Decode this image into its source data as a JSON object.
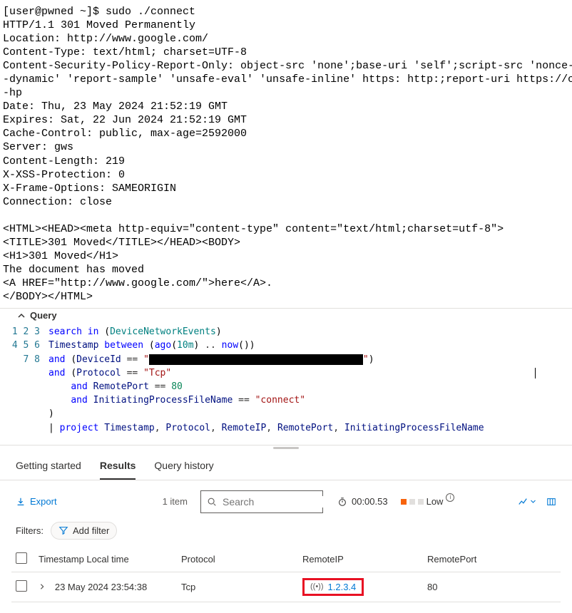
{
  "terminal": {
    "text": "[user@pwned ~]$ sudo ./connect\nHTTP/1.1 301 Moved Permanently\nLocation: http://www.google.com/\nContent-Type: text/html; charset=UTF-8\nContent-Security-Policy-Report-Only: object-src 'none';base-uri 'self';script-src 'nonce-\n-dynamic' 'report-sample' 'unsafe-eval' 'unsafe-inline' https: http:;report-uri https://c\n-hp\nDate: Thu, 23 May 2024 21:52:19 GMT\nExpires: Sat, 22 Jun 2024 21:52:19 GMT\nCache-Control: public, max-age=2592000\nServer: gws\nContent-Length: 219\nX-XSS-Protection: 0\nX-Frame-Options: SAMEORIGIN\nConnection: close\n\n<HTML><HEAD><meta http-equiv=\"content-type\" content=\"text/html;charset=utf-8\">\n<TITLE>301 Moved</TITLE></HEAD><BODY>\n<H1>301 Moved</H1>\nThe document has moved\n<A HREF=\"http://www.google.com/\">here</A>.\n</BODY></HTML>"
  },
  "query": {
    "header": "Query",
    "lines": {
      "l1": {
        "search": "search",
        "in": "in",
        "table": "DeviceNetworkEvents"
      },
      "l2": {
        "col": "Timestamp",
        "between": "between",
        "ago": "ago",
        "tenm": "10m",
        "now": "now"
      },
      "l3": {
        "and": "and",
        "col": "DeviceId",
        "eq": "==",
        "strq": "\"",
        "closeq": "\""
      },
      "l4": {
        "and": "and",
        "col": "Protocol",
        "eq": "==",
        "val": "\"Tcp\""
      },
      "l5": {
        "and": "and",
        "col": "RemotePort",
        "eq": "==",
        "val": "80"
      },
      "l6": {
        "and": "and",
        "col": "InitiatingProcessFileName",
        "eq": "==",
        "val": "\"connect\""
      },
      "l7": {
        "paren": ")"
      },
      "l8": {
        "pipe": "|",
        "project": "project",
        "c1": "Timestamp",
        "c2": "Protocol",
        "c3": "RemoteIP",
        "c4": "RemotePort",
        "c5": "InitiatingProcessFileName"
      }
    }
  },
  "tabs": {
    "getting_started": "Getting started",
    "results": "Results",
    "history": "Query history"
  },
  "toolbar": {
    "export": "Export",
    "item_count": "1 item",
    "search_placeholder": "Search",
    "timer": "00:00.53",
    "severity": "Low"
  },
  "filters": {
    "label": "Filters:",
    "add": "Add filter"
  },
  "table": {
    "headers": {
      "timestamp": "Timestamp Local time",
      "protocol": "Protocol",
      "remoteip": "RemoteIP",
      "remoteport": "RemotePort"
    },
    "row": {
      "timestamp": "23 May 2024 23:54:38",
      "protocol": "Tcp",
      "remoteip": "1.2.3.4",
      "remoteport": "80"
    }
  }
}
